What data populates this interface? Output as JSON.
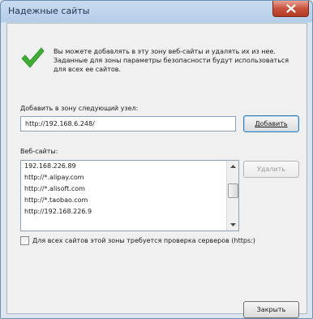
{
  "window": {
    "title": "Надежные сайты"
  },
  "info": {
    "text": "Вы можете добавлять в эту зону веб-сайты и удалять их из нее. Заданные для зоны параметры безопасности будут использоваться для всех ее сайтов.",
    "icon": "checkmark-icon"
  },
  "add_zone": {
    "label": "Добавить в зону следующий узел:",
    "value": "http://192.168.6.248/",
    "button_label": "Добавить"
  },
  "websites": {
    "label": "Веб-сайты:",
    "items": [
      "192.168.226.89",
      "http://*.alipay.com",
      "http://*.alisoft.com",
      "http://*.taobao.com",
      "http://192.168.226.9"
    ],
    "remove_label": "Удалить"
  },
  "https_check": {
    "label": "Для всех сайтов этой зоны требуется проверка серверов (https:)",
    "checked": false
  },
  "footer": {
    "close_label": "Закрыть"
  }
}
